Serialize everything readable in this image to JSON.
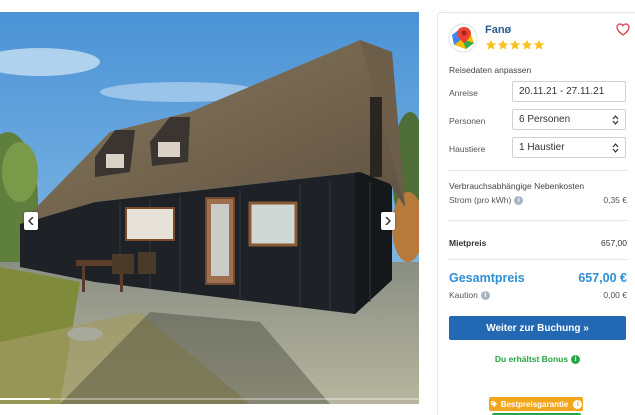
{
  "gallery": {
    "prev_icon": "chevron-left-icon",
    "next_icon": "chevron-right-icon",
    "progress": 0.12
  },
  "listing": {
    "place": "Fanø",
    "stars": 5,
    "logo_icon": "map-pin-icon",
    "favorite_icon": "heart-outline-icon"
  },
  "travel": {
    "section_title": "Reisedaten anpassen",
    "date_label": "Anreise",
    "date_value": "20.11.21 - 27.11.21",
    "persons_label": "Personen",
    "persons_value": "6 Personen",
    "pets_label": "Haustiere",
    "pets_value": "1 Haustier"
  },
  "costs": {
    "section_title": "Verbrauchsabhängige Nebenkosten",
    "power_label": "Strom (pro kWh)",
    "power_value": "0,35 €",
    "rent_label": "Mietpreis",
    "rent_value": "657,00",
    "total_label": "Gesamtpreis",
    "total_value": "657,00 €",
    "deposit_label": "Kaution",
    "deposit_value": "0,00 €"
  },
  "actions": {
    "book_label": "Weiter zur Buchung »",
    "bonus_label": "Du erhältst Bonus",
    "guarantee_label": "Bestpreisgarantie"
  },
  "colors": {
    "accent": "#2368b3",
    "total": "#2d8fd5",
    "bonus": "#27a647",
    "guarantee": "#f2a61c",
    "stars": "#f6c21c"
  }
}
